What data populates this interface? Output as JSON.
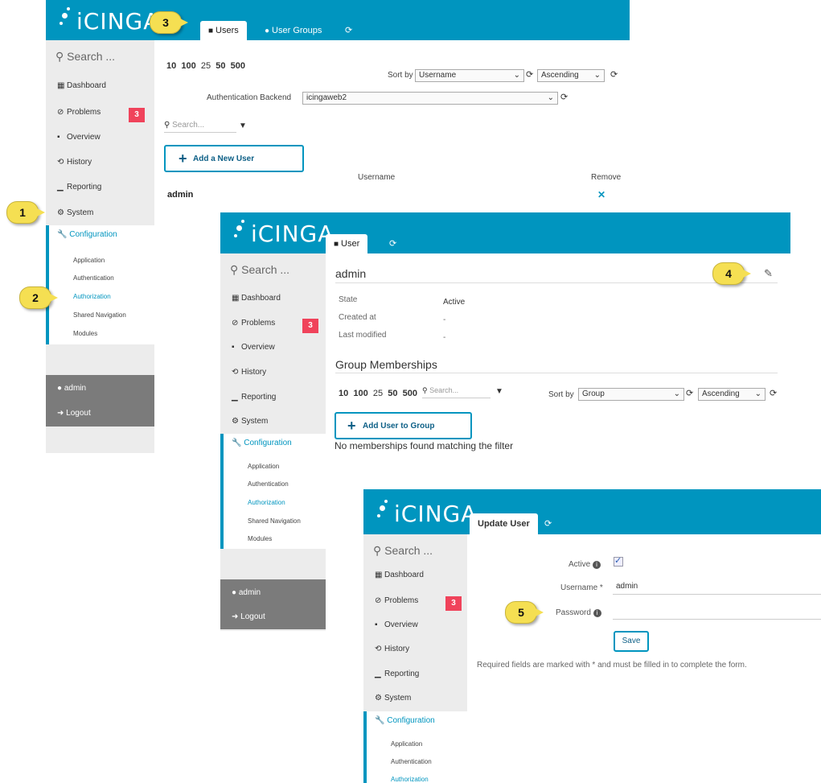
{
  "logo_text": "iCINGA",
  "callouts": [
    "1",
    "2",
    "3",
    "4",
    "5"
  ],
  "sidebar": {
    "search": "Search ...",
    "items": [
      {
        "label": "Dashboard",
        "icon": "grid-icon"
      },
      {
        "label": "Problems",
        "icon": "ban-icon",
        "badge": "3"
      },
      {
        "label": "Overview",
        "icon": "sitemap-icon"
      },
      {
        "label": "History",
        "icon": "history-icon"
      },
      {
        "label": "Reporting",
        "icon": "bars-icon"
      },
      {
        "label": "System",
        "icon": "gears-icon"
      }
    ],
    "configuration": "Configuration",
    "config_items": [
      "Application",
      "Authentication",
      "Authorization",
      "Shared Navigation",
      "Modules"
    ],
    "user": "admin",
    "logout": "Logout"
  },
  "win1": {
    "tabs": [
      "Users",
      "User Groups"
    ],
    "limits": [
      "10",
      "100",
      "25",
      "50",
      "500"
    ],
    "sort_label": "Sort by",
    "sort_field": "Username",
    "sort_order": "Ascending",
    "backend_label": "Authentication Backend",
    "backend_value": "icingaweb2",
    "search_placeholder": "Search...",
    "add_button": "Add a New User",
    "col_username": "Username",
    "col_remove": "Remove",
    "rows": [
      {
        "username": "admin",
        "remove": "✕"
      }
    ]
  },
  "win2": {
    "tab": "User",
    "title": "admin",
    "state_label": "State",
    "state_value": "Active",
    "created_label": "Created at",
    "created_value": "-",
    "modified_label": "Last modified",
    "modified_value": "-",
    "group_title": "Group Memberships",
    "limits": [
      "10",
      "100",
      "25",
      "50",
      "500"
    ],
    "search_placeholder": "Search...",
    "sort_label": "Sort by",
    "sort_field": "Group",
    "sort_order": "Ascending",
    "add_button": "Add User to Group",
    "empty_msg": "No memberships found matching the filter"
  },
  "win3": {
    "tab": "Update User",
    "active_label": "Active",
    "username_label": "Username *",
    "username_value": "admin",
    "password_label": "Password",
    "save_button": "Save",
    "required_note": "Required fields are marked with * and must be filled in to complete the form."
  }
}
